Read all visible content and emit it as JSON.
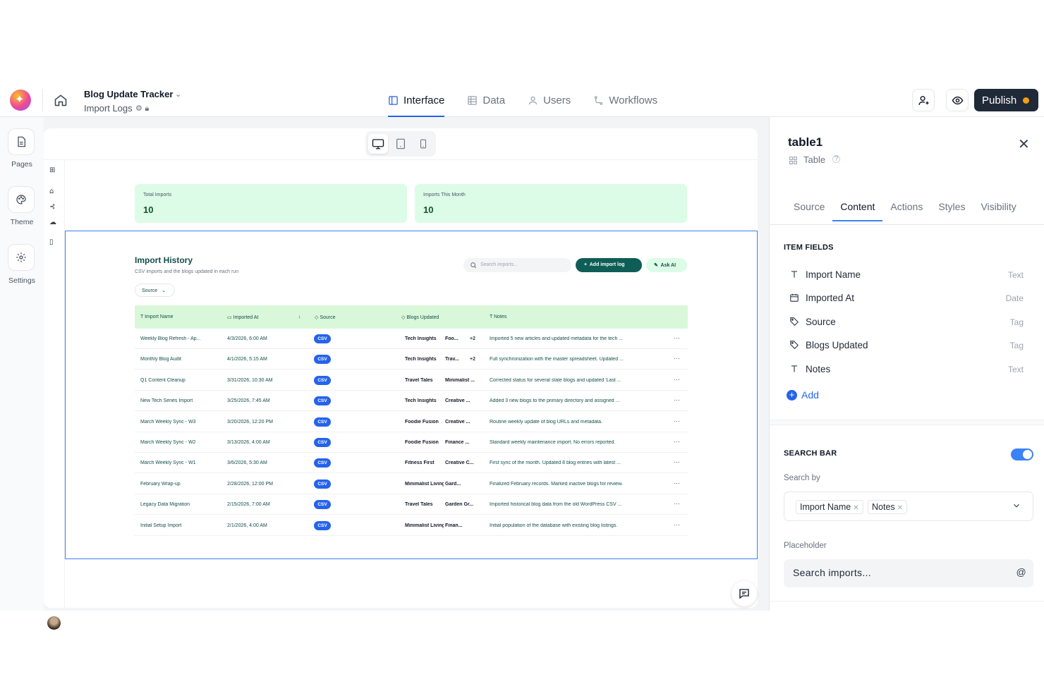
{
  "topbar": {
    "app_name": "Blog Update Tracker",
    "page_name": "Import Logs",
    "nav_tabs": [
      {
        "label": "Interface",
        "active": true,
        "icon": "sidebar-icon"
      },
      {
        "label": "Data",
        "active": false,
        "icon": "table-icon"
      },
      {
        "label": "Users",
        "active": false,
        "icon": "user-icon"
      },
      {
        "label": "Workflows",
        "active": false,
        "icon": "workflow-icon"
      }
    ],
    "publish_label": "Publish",
    "colors": {
      "accent": "#2563eb",
      "publish_bg": "#1f2937",
      "publish_dot": "#f59e0b"
    }
  },
  "left_rail": {
    "items": [
      {
        "label": "Pages",
        "icon": "page-icon"
      },
      {
        "label": "Theme",
        "icon": "palette-icon"
      },
      {
        "label": "Settings",
        "icon": "gear-icon"
      }
    ]
  },
  "canvas": {
    "stats": [
      {
        "label": "Total Imports",
        "value": "10"
      },
      {
        "label": "Imports This Month",
        "value": "10"
      }
    ],
    "table_title": "Import History",
    "table_subtitle": "CSV imports and the blogs updated in each run",
    "source_filter": "Source",
    "search_placeholder": "Search imports...",
    "add_button": "Add import log",
    "ask_ai": "Ask AI",
    "columns": [
      "Import Name",
      "Imported At",
      "Source",
      "Blogs Updated",
      "Notes"
    ],
    "rows": [
      {
        "name": "Weekly Blog Refresh - Ap...",
        "at": "4/3/2026, 6:00 AM",
        "source": "CSV",
        "blog1": "Tech Insights",
        "blog2": "Foo...",
        "extra": "+2",
        "notes": "Imported 5 new articles and updated metadata for the tech ..."
      },
      {
        "name": "Monthly Blog Audit",
        "at": "4/1/2026, 5:15 AM",
        "source": "CSV",
        "blog1": "Tech Insights",
        "blog2": "Trav...",
        "extra": "+2",
        "notes": "Full synchronization with the master spreadsheet. Updated ..."
      },
      {
        "name": "Q1 Content Cleanup",
        "at": "3/31/2026, 10:30 AM",
        "source": "CSV",
        "blog1": "Travel Tales",
        "blog2": "Minimalist ...",
        "extra": "",
        "notes": "Corrected status for several stale blogs and updated 'Last ..."
      },
      {
        "name": "New Tech Series Import",
        "at": "3/25/2026, 7:45 AM",
        "source": "CSV",
        "blog1": "Tech Insights",
        "blog2": "Creative ...",
        "extra": "",
        "notes": "Added 3 new blogs to the primary directory and assigned ..."
      },
      {
        "name": "March Weekly Sync - W3",
        "at": "3/20/2026, 12:20 PM",
        "source": "CSV",
        "blog1": "Foodie Fusion",
        "blog2": "Creative ...",
        "extra": "",
        "notes": "Routine weekly update of blog URLs and metadata."
      },
      {
        "name": "March Weekly Sync - W2",
        "at": "3/13/2026, 4:00 AM",
        "source": "CSV",
        "blog1": "Foodie Fusion",
        "blog2": "Finance ...",
        "extra": "",
        "notes": "Standard weekly maintenance import. No errors reported."
      },
      {
        "name": "March Weekly Sync - W1",
        "at": "3/6/2026, 5:30 AM",
        "source": "CSV",
        "blog1": "Fitness First",
        "blog2": "Creative C...",
        "extra": "",
        "notes": "First sync of the month. Updated 8 blog entries with latest ..."
      },
      {
        "name": "February Wrap-up",
        "at": "2/28/2026, 12:00 PM",
        "source": "CSV",
        "blog1": "Minimalist Living",
        "blog2": "Gard...",
        "extra": "",
        "notes": "Finalized February records. Marked inactive blogs for review."
      },
      {
        "name": "Legacy Data Migration",
        "at": "2/15/2026, 7:00 AM",
        "source": "CSV",
        "blog1": "Travel Tales",
        "blog2": "Garden Gr...",
        "extra": "",
        "notes": "Imported historical blog data from the old WordPress CSV ..."
      },
      {
        "name": "Initial Setup Import",
        "at": "2/1/2026, 4:00 AM",
        "source": "CSV",
        "blog1": "Minimalist Living",
        "blog2": "Finan...",
        "extra": "",
        "notes": "Initial population of the database with existing blog listings."
      }
    ],
    "colors": {
      "stat_bg": "#dcfce7",
      "header_bg": "#d9f7d9",
      "primary": "#0f5d57",
      "csv_badge": "#2563eb"
    }
  },
  "panel": {
    "title": "table1",
    "type": "Table",
    "tabs": [
      {
        "label": "Source",
        "active": false
      },
      {
        "label": "Content",
        "active": true
      },
      {
        "label": "Actions",
        "active": false
      },
      {
        "label": "Styles",
        "active": false
      },
      {
        "label": "Visibility",
        "active": false
      }
    ],
    "item_fields_heading": "ITEM FIELDS",
    "item_fields": [
      {
        "name": "Import Name",
        "type": "Text",
        "icon": "text-icon"
      },
      {
        "name": "Imported At",
        "type": "Date",
        "icon": "calendar-icon"
      },
      {
        "name": "Source",
        "type": "Tag",
        "icon": "tag-icon"
      },
      {
        "name": "Blogs Updated",
        "type": "Tag",
        "icon": "tag-icon"
      },
      {
        "name": "Notes",
        "type": "Text",
        "icon": "text-icon"
      }
    ],
    "add_label": "Add",
    "search_bar_heading": "SEARCH BAR",
    "search_bar_enabled": true,
    "search_by_label": "Search by",
    "search_by_values": [
      "Import Name",
      "Notes"
    ],
    "placeholder_label": "Placeholder",
    "placeholder_value": "Search imports..."
  }
}
